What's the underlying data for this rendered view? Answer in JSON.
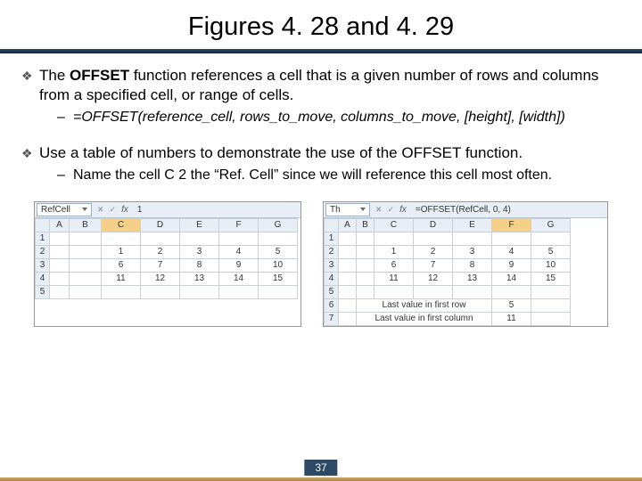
{
  "title": "Figures 4. 28 and 4. 29",
  "bullet1_pre": "The ",
  "bullet1_bold": "OFFSET",
  "bullet1_post": " function references a cell that is a given number of rows and columns from a specified cell, or range of cells.",
  "sub1": "=OFFSET(reference_cell, rows_to_move, columns_to_move, [height], [width])",
  "bullet2": "Use a table of numbers to demonstrate the use of the OFFSET function.",
  "sub2": "Name the cell C 2 the “Ref. Cell” since we will reference this cell most often.",
  "pageNum": "37",
  "shot1": {
    "namebox": "RefCell",
    "fx": "fx",
    "formula": "1",
    "cols": [
      "A",
      "B",
      "C",
      "D",
      "E",
      "F",
      "G"
    ],
    "rows": [
      {
        "r": "1",
        "cells": [
          "",
          "",
          "",
          "",
          "",
          "",
          ""
        ]
      },
      {
        "r": "2",
        "cells": [
          "",
          "",
          "1",
          "2",
          "3",
          "4",
          "5"
        ]
      },
      {
        "r": "3",
        "cells": [
          "",
          "",
          "6",
          "7",
          "8",
          "9",
          "10"
        ]
      },
      {
        "r": "4",
        "cells": [
          "",
          "",
          "11",
          "12",
          "13",
          "14",
          "15"
        ]
      },
      {
        "r": "5",
        "cells": [
          "",
          "",
          "",
          "",
          "",
          "",
          ""
        ]
      }
    ]
  },
  "shot2": {
    "namebox": "Th",
    "fx": "fx",
    "formula": "=OFFSET(RefCell, 0, 4)",
    "cols": [
      "A",
      "B",
      "C",
      "D",
      "E",
      "F",
      "G"
    ],
    "rows": [
      {
        "r": "1",
        "cells": [
          "",
          "",
          "",
          "",
          "",
          "",
          ""
        ]
      },
      {
        "r": "2",
        "cells": [
          "",
          "",
          "1",
          "2",
          "3",
          "4",
          "5"
        ]
      },
      {
        "r": "3",
        "cells": [
          "",
          "",
          "6",
          "7",
          "8",
          "9",
          "10"
        ]
      },
      {
        "r": "4",
        "cells": [
          "",
          "",
          "11",
          "12",
          "13",
          "14",
          "15"
        ]
      },
      {
        "r": "5",
        "cells": [
          "",
          "",
          "",
          "",
          "",
          "",
          ""
        ]
      },
      {
        "r": "6",
        "cells": [
          "",
          "Last value in first row",
          "",
          "",
          "",
          "5",
          ""
        ]
      },
      {
        "r": "7",
        "cells": [
          "",
          "Last value in first column",
          "",
          "",
          "",
          "11",
          ""
        ]
      }
    ]
  }
}
